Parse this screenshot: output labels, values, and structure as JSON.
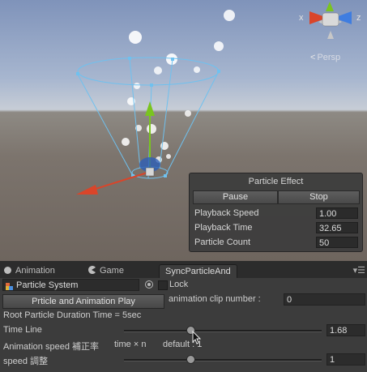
{
  "scene": {
    "persp_label": "Persp",
    "gizmo_x": "x",
    "gizmo_z": "z"
  },
  "particle_effect": {
    "title": "Particle Effect",
    "pause_label": "Pause",
    "stop_label": "Stop",
    "rows": [
      {
        "label": "Playback Speed",
        "value": "1.00"
      },
      {
        "label": "Playback Time",
        "value": "32.65"
      },
      {
        "label": "Particle Count",
        "value": "50"
      }
    ]
  },
  "tabs": {
    "animation": "Animation",
    "game": "Game",
    "sync": "SyncParticleAnd"
  },
  "inspector": {
    "object_field": "Particle System",
    "lock_label": "Lock",
    "play_button": "Prticle and Animation Play",
    "clip_number_label": "animation clip number :",
    "clip_number_value": "0",
    "duration_label": "Root Particle Duration Time = 5sec",
    "timeline_label": "Time Line",
    "timeline_value": "1.68",
    "timeline_fraction": 0.336,
    "anim_speed_label": "Animation speed 補正率",
    "anim_speed_formula": "time × n",
    "anim_speed_default": "default : 1",
    "speed_label": "speed 調整",
    "speed_value": "1",
    "speed_fraction": 0.336
  },
  "colors": {
    "x_axis": "#d9452a",
    "y_axis": "#7ac41f",
    "z_axis": "#3f7de0",
    "emitter_lines": "#6fc1ef"
  }
}
